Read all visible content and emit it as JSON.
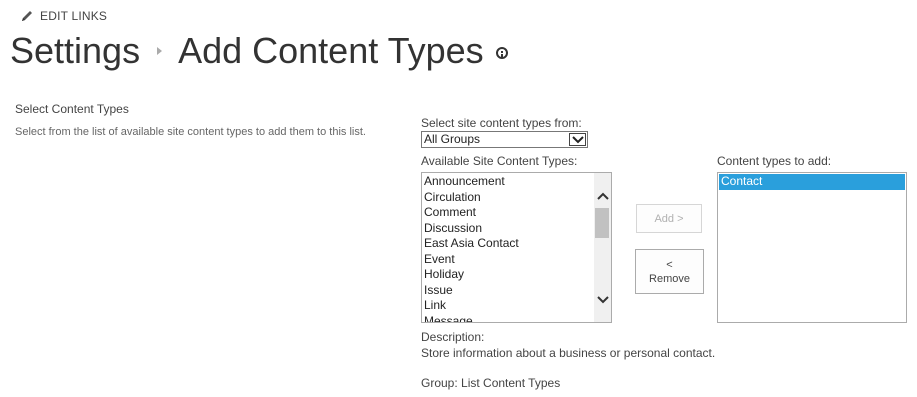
{
  "edit_links": {
    "label": "EDIT LINKS"
  },
  "breadcrumb": {
    "root": "Settings",
    "current": "Add Content Types"
  },
  "section": {
    "heading": "Select Content Types",
    "description": "Select from the list of available site content types to add them to this list."
  },
  "source": {
    "label": "Select site content types from:",
    "selected": "All Groups"
  },
  "available": {
    "label": "Available Site Content Types:",
    "items": [
      "Announcement",
      "Circulation",
      "Comment",
      "Discussion",
      "East Asia Contact",
      "Event",
      "Holiday",
      "Issue",
      "Link",
      "Message"
    ]
  },
  "to_add": {
    "label": "Content types to add:",
    "items": [
      "Contact"
    ]
  },
  "buttons": {
    "add": "Add >",
    "remove_line1": "<",
    "remove_line2": "Remove"
  },
  "description": {
    "label": "Description:",
    "text": "Store information about a business or personal contact."
  },
  "group": {
    "text": "Group: List Content Types"
  },
  "colors": {
    "selection": "#2a9fdc",
    "text": "#444444",
    "disabled": "#b1b1b1"
  },
  "icons": {
    "edit": "pencil-icon",
    "info": "info-icon",
    "dropdown": "chevron-down-icon"
  }
}
